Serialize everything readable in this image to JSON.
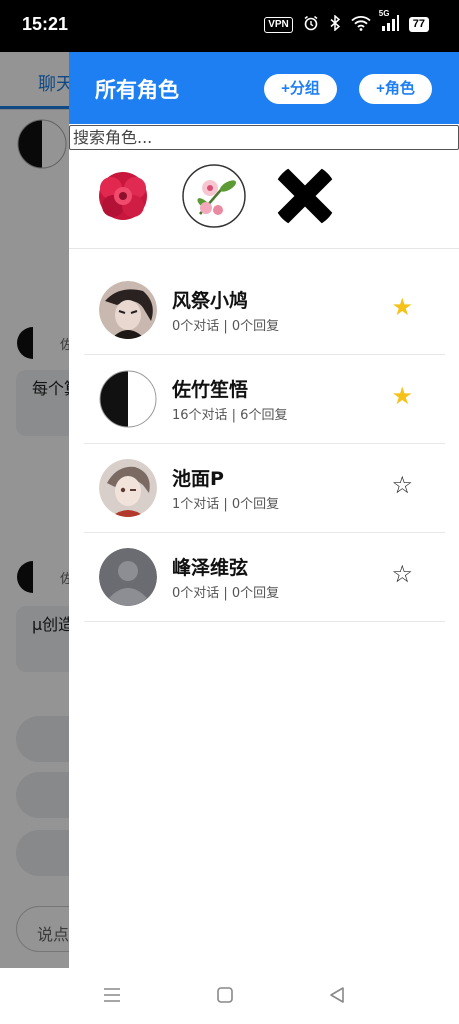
{
  "status_bar": {
    "time": "15:21",
    "vpn": "VPN",
    "network": "5G",
    "battery": "77",
    "icons": [
      "alarm-icon",
      "bluetooth-icon",
      "wifi-icon",
      "signal-icon",
      "battery-icon"
    ]
  },
  "background_app": {
    "tab_label": "聊天",
    "messages": [
      {
        "sender_initial": "佐",
        "text": "每个算是"
      },
      {
        "sender_initial": "佐",
        "text": "μ创造的一"
      }
    ],
    "input_placeholder": "说点"
  },
  "drawer": {
    "title": "所有角色",
    "add_group_label": "+分组",
    "add_role_label": "+角色",
    "search_placeholder": "搜索角色...",
    "groups": [
      {
        "icon": "red-flower-icon"
      },
      {
        "icon": "blossom-flower-icon"
      },
      {
        "icon": "black-cross-icon"
      }
    ],
    "roles": [
      {
        "name": "风祭小鸠",
        "stats": "0个对话 | 0个回复",
        "starred": true,
        "star": "★"
      },
      {
        "name": "佐竹笙悟",
        "stats": "16个对话 | 6个回复",
        "starred": true,
        "star": "★"
      },
      {
        "name": "池面P",
        "stats": "1个对话 | 0个回复",
        "starred": false,
        "star": "☆"
      },
      {
        "name": "峰泽维弦",
        "stats": "0个对话 | 0个回复",
        "starred": false,
        "star": "☆"
      }
    ]
  },
  "colors": {
    "accent": "#1e7ff2",
    "star_active": "#f5c21a"
  },
  "nav_bar": {
    "icons": [
      "menu-icon",
      "home-icon",
      "back-icon"
    ]
  }
}
